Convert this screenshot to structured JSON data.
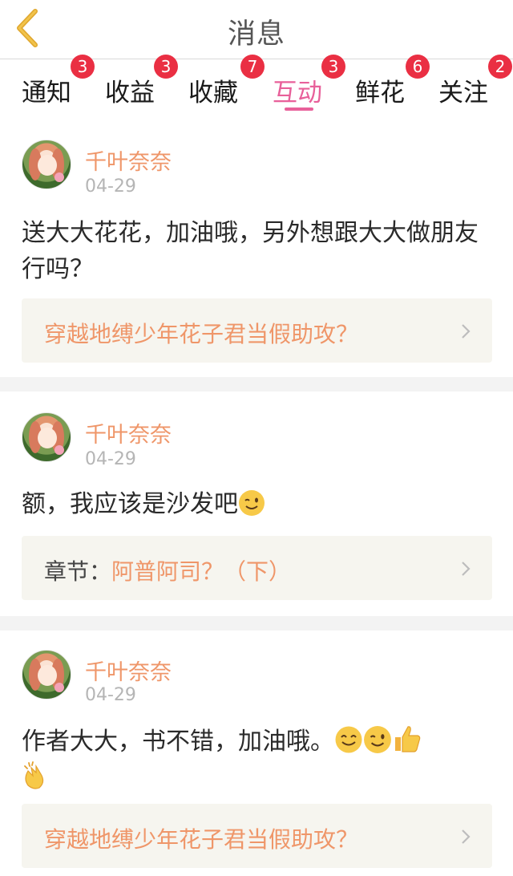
{
  "header": {
    "title": "消息"
  },
  "tabs": [
    {
      "label": "通知",
      "badge": "3"
    },
    {
      "label": "收益",
      "badge": "3"
    },
    {
      "label": "收藏",
      "badge": "7"
    },
    {
      "label": "互动",
      "badge": "3",
      "active": true
    },
    {
      "label": "鲜花",
      "badge": "6"
    },
    {
      "label": "关注",
      "badge": "2"
    }
  ],
  "messages": [
    {
      "username": "千叶奈奈",
      "date": "04-29",
      "text": "送大大花花，加油哦，另外想跟大大做朋友行吗？",
      "emojis": [],
      "link": {
        "prefix": "",
        "title": "穿越地缚少年花子君当假助攻？"
      }
    },
    {
      "username": "千叶奈奈",
      "date": "04-29",
      "text": "额，我应该是沙发吧",
      "emojis": [
        "wink-emoji"
      ],
      "link": {
        "prefix": "章节：",
        "title": "阿普阿司？（下）"
      }
    },
    {
      "username": "千叶奈奈",
      "date": "04-29",
      "text": "作者大大，书不错，加油哦。",
      "emojis": [
        "smile-emoji",
        "wink-emoji",
        "thumbs-up-emoji",
        "clapping-hands-emoji"
      ],
      "link": {
        "prefix": "",
        "title": "穿越地缚少年花子君当假助攻？"
      }
    }
  ],
  "colors": {
    "accent": "#e8609a",
    "name": "#ef9669",
    "badge": "#ea2f43",
    "link_bg": "#f6f5ef"
  },
  "icons": {
    "back": "chevron-left-icon",
    "link_arrow": "chevron-right-icon"
  }
}
